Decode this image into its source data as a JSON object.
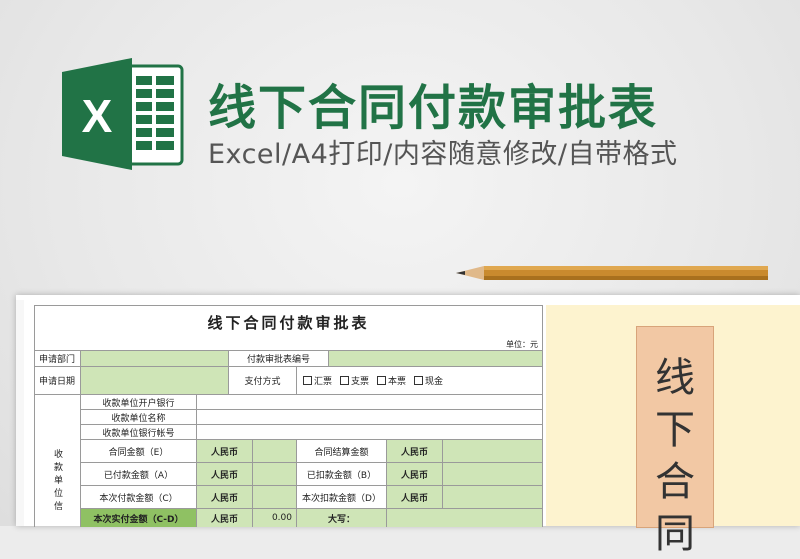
{
  "header": {
    "title": "线下合同付款审批表",
    "subtitle": "Excel/A4打印/内容随意修改/自带格式",
    "logo_letter": "X"
  },
  "colors": {
    "excel_green": "#217346",
    "cell_green": "#cfe5b7",
    "cell_dark_green": "#8fc163",
    "panel_bg": "#fdf3cf",
    "banner_bg": "#f2c8a4"
  },
  "sheet": {
    "title": "线下合同付款审批表",
    "unit": "单位：元",
    "rows": {
      "apply_dept": "申请部门",
      "approval_no": "付款审批表编号",
      "apply_date": "申请日期",
      "pay_method": "支付方式",
      "pay_options": [
        "汇票",
        "支票",
        "本票",
        "现金"
      ],
      "payee_bank": "收款单位开户银行",
      "payee_name": "收款单位名称",
      "payee_account": "收款单位银行帐号",
      "payee_info_vertical": "收款单位信",
      "contract_amount": "合同金额（E）",
      "settle_amount": "合同结算金额",
      "paid_amount": "已付款金额（A）",
      "deducted_amount": "已扣款金额（B）",
      "this_pay": "本次付款金额（C）",
      "this_deduct": "本次扣款金额（D）",
      "actual_pay": "本次实付金额（C-D）",
      "currency": "人民币",
      "amount_value": "0.00",
      "uppercase": "大写："
    }
  },
  "banner": {
    "chars": [
      "线",
      "下",
      "合",
      "同"
    ]
  }
}
